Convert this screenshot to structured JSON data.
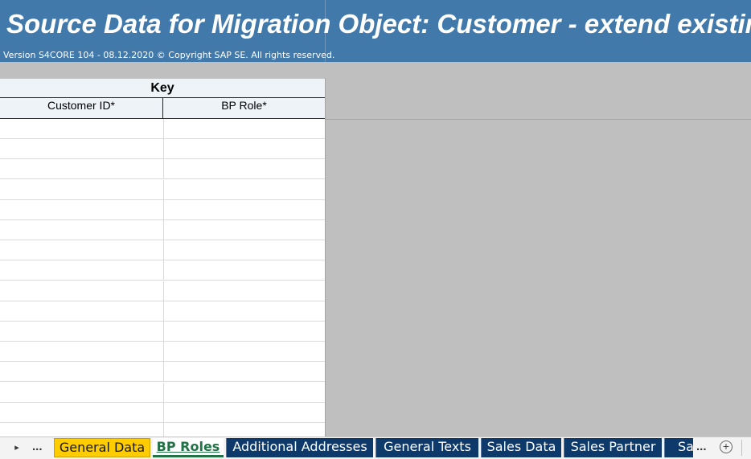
{
  "banner": {
    "title": "Source Data for Migration Object:  Customer - extend existing record by new org levels",
    "version": "Version S4CORE 104  - 08.12.2020 © Copyright SAP SE. All rights reserved."
  },
  "table": {
    "group_header": "Key",
    "columns": [
      "Customer ID*",
      "BP Role*"
    ],
    "empty_rows": 16
  },
  "tabbar": {
    "nav_arrow": "▸",
    "nav_more": "...",
    "tabs": [
      {
        "label": "General Data",
        "state": "colored-yellow"
      },
      {
        "label": "BP Roles",
        "state": "active"
      },
      {
        "label": "Additional Addresses",
        "state": "colored-dark"
      },
      {
        "label": "General Texts",
        "state": "colored-dark"
      },
      {
        "label": "Sales Data",
        "state": "colored-dark"
      },
      {
        "label": "Sales Partner",
        "state": "colored-dark"
      },
      {
        "label": "Sa",
        "state": "colored-dark"
      }
    ],
    "more_tabs": "...",
    "add_sheet": "+"
  },
  "colors": {
    "banner": "#4279ab",
    "tab_dark": "#0d3a6b",
    "tab_yellow": "#ffcc00",
    "active_tab_text": "#217346",
    "empty_area": "#bfbfbf"
  }
}
